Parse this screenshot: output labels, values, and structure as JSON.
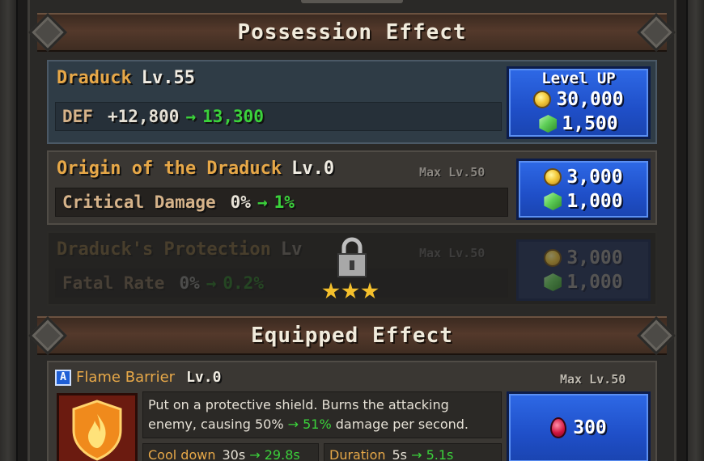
{
  "possession_header": "Possession Effect",
  "equipped_header": "Equipped Effect",
  "main_row": {
    "name": "Draduck",
    "level": "Lv.55",
    "stat_name": "DEF",
    "stat_from": "+12,800",
    "stat_to": "13,300",
    "button": {
      "title": "Level UP",
      "gold": "30,000",
      "gem": "1,500"
    }
  },
  "origin_row": {
    "name": "Origin of the Draduck",
    "level": "Lv.0",
    "max_level": "Max Lv.50",
    "stat_name": "Critical Damage",
    "stat_from": "0%",
    "stat_to": "1%",
    "button": {
      "gold": "3,000",
      "gem": "1,000"
    }
  },
  "protection_row": {
    "name": "Draduck's Protection",
    "level": "Lv",
    "max_level": "Max Lv.50",
    "stat_name": "Fatal Rate",
    "stat_from": "0%",
    "stat_to": "0.2%",
    "button": {
      "gold": "3,000",
      "gem": "1,000"
    },
    "locked": true,
    "required_stars": 3
  },
  "equipped": {
    "grade": "A",
    "skill_name": "Flame Barrier",
    "level": "Lv.0",
    "max_level": "Max Lv.50",
    "desc_part1": "Put on a protective shield. Burns the attacking enemy, causing 50% ",
    "desc_arrow": "→ 51%",
    "desc_part2": " damage per second.",
    "cooldown_label": "Cool down",
    "cooldown_from": "30s",
    "cooldown_to": "29.8s",
    "duration_label": "Duration",
    "duration_from": "5s",
    "duration_to": "5.1s",
    "button": {
      "ruby": "300"
    }
  },
  "arrow_glyph": "→",
  "colors": {
    "accent_orange": "#e7a848",
    "green": "#3bd23b",
    "button_blue": "#2e69e6"
  }
}
